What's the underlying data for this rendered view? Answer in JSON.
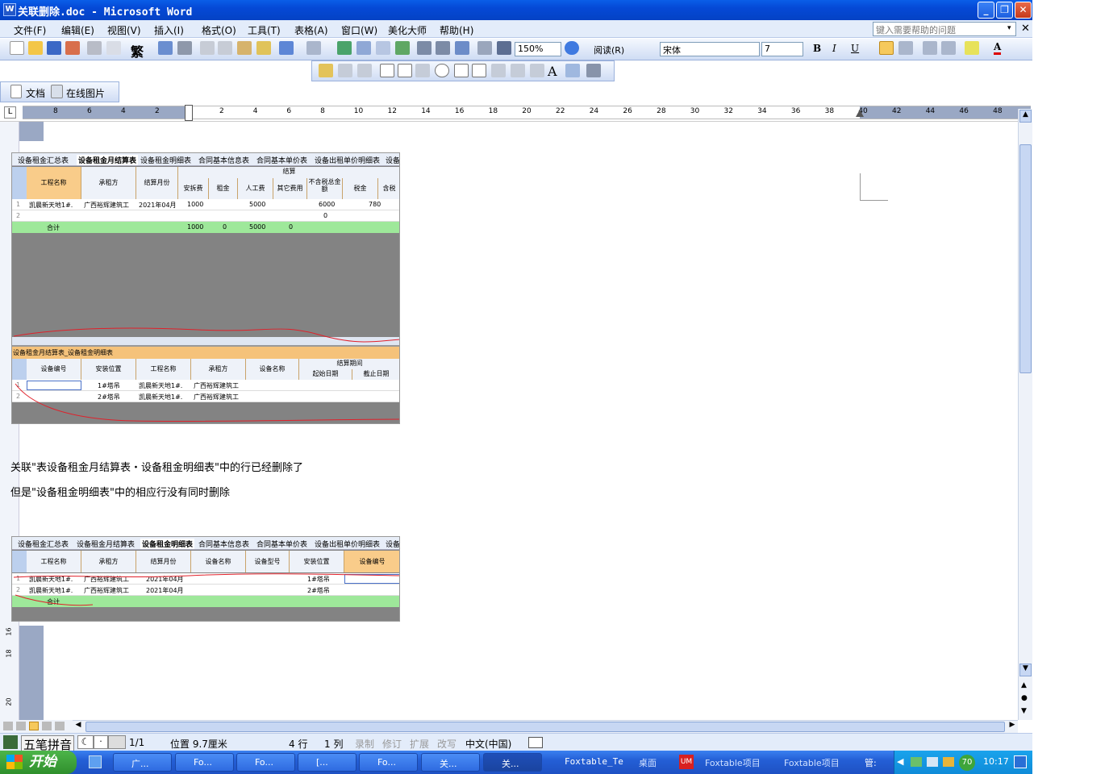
{
  "window": {
    "title": "关联删除.doc - Microsoft Word"
  },
  "menu": [
    "文件(F)",
    "编辑(E)",
    "视图(V)",
    "插入(I)",
    "格式(O)",
    "工具(T)",
    "表格(A)",
    "窗口(W)",
    "美化大师",
    "帮助(H)"
  ],
  "help_placeholder": "键入需要帮助的问题",
  "toolbar": {
    "zoom": "150%",
    "read_label": "阅读(R)",
    "font_name": "宋体",
    "font_size": "7",
    "trad_label": "繁"
  },
  "toolbar3": {
    "doc_label": "文档",
    "online_pic_label": "在线图片"
  },
  "ruler_ticks": [
    "8",
    "6",
    "4",
    "2",
    "2",
    "4",
    "6",
    "8",
    "10",
    "12",
    "14",
    "16",
    "18",
    "20",
    "22",
    "24",
    "26",
    "28",
    "30",
    "32",
    "34",
    "36",
    "38",
    "40",
    "42",
    "44",
    "46",
    "48"
  ],
  "left_ruler": [
    "16",
    "18",
    "20"
  ],
  "shot1": {
    "tabs": [
      "设备租金汇总表",
      "设备租金月结算表",
      "设备租金明细表",
      "合同基本信息表",
      "合同基本单价表",
      "设备出租单价明细表",
      "设备"
    ],
    "headers": [
      "工程名称",
      "承租方",
      "结算月份",
      "结算",
      "安拆费",
      "租金",
      "人工费",
      "其它费用",
      "不含税总金额",
      "税金",
      "含税"
    ],
    "rows": [
      [
        "1",
        "凯晨新天地1#.",
        "广西裕辉建筑工",
        "2021年04月",
        "1000",
        "",
        "5000",
        "",
        "6000",
        "780"
      ],
      [
        "2",
        "",
        "",
        "",
        "",
        "",
        "",
        "",
        "0",
        ""
      ]
    ],
    "total": [
      "合计",
      "1000",
      "0",
      "5000",
      "0"
    ]
  },
  "shot2": {
    "tabs": "设备租金月结算表_设备租金明细表",
    "headers": [
      "设备编号",
      "安装位置",
      "工程名称",
      "承租方",
      "设备名称",
      "结算期间",
      "起始日期",
      "截止日期"
    ],
    "rows": [
      [
        "1",
        "",
        "1#塔吊",
        "凯晨新天地1#.",
        "广西裕辉建筑工"
      ],
      [
        "2",
        "",
        "2#塔吊",
        "凯晨新天地1#.",
        "广西裕辉建筑工"
      ]
    ]
  },
  "para1": "关联\"表设备租金月结算表・设备租金明细表\"中的行已经删除了",
  "para2": "但是\"设备租金明细表\"中的相应行没有同时删除",
  "shot3": {
    "tabs": [
      "设备租金汇总表",
      "设备租金月结算表",
      "设备租金明细表",
      "合同基本信息表",
      "合同基本单价表",
      "设备出租单价明细表",
      "设备"
    ],
    "headers": [
      "工程名称",
      "承租方",
      "结算月份",
      "设备名称",
      "设备型号",
      "安装位置",
      "设备编号"
    ],
    "rows": [
      [
        "1",
        "凯晨新天地1#.",
        "广西裕辉建筑工",
        "2021年04月",
        "",
        "",
        "1#塔吊"
      ],
      [
        "2",
        "凯晨新天地1#.",
        "广西裕辉建筑工",
        "2021年04月",
        "",
        "",
        "2#塔吊"
      ]
    ],
    "total": "合计"
  },
  "status": {
    "page": "1/1",
    "position": "位置 9.7厘米",
    "line": "4 行",
    "col": "1 列",
    "rec": "录制",
    "trk": "修订",
    "ext": "扩展",
    "ovr": "改写",
    "lang": "中文(中国)"
  },
  "ime": "五笔拼音",
  "taskbar": {
    "start": "开始",
    "tasks": [
      "广...",
      "Fo...",
      "Fo...",
      "[...",
      "Fo...",
      "关...",
      "关..."
    ],
    "folder": "Foxtable_Te",
    "extras": [
      "桌面",
      "Foxtable项目",
      "Foxtable项目",
      "管:"
    ],
    "tray_num": "70",
    "clock": "10:17"
  }
}
